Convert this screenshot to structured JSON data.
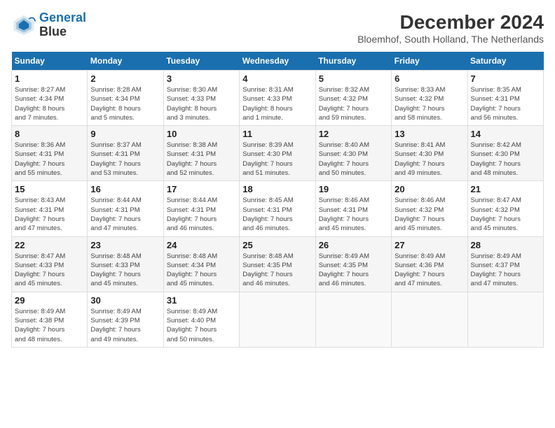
{
  "header": {
    "logo_line1": "General",
    "logo_line2": "Blue",
    "month_title": "December 2024",
    "subtitle": "Bloemhof, South Holland, The Netherlands"
  },
  "columns": [
    "Sunday",
    "Monday",
    "Tuesday",
    "Wednesday",
    "Thursday",
    "Friday",
    "Saturday"
  ],
  "weeks": [
    [
      {
        "day": "1",
        "info": "Sunrise: 8:27 AM\nSunset: 4:34 PM\nDaylight: 8 hours\nand 7 minutes."
      },
      {
        "day": "2",
        "info": "Sunrise: 8:28 AM\nSunset: 4:34 PM\nDaylight: 8 hours\nand 5 minutes."
      },
      {
        "day": "3",
        "info": "Sunrise: 8:30 AM\nSunset: 4:33 PM\nDaylight: 8 hours\nand 3 minutes."
      },
      {
        "day": "4",
        "info": "Sunrise: 8:31 AM\nSunset: 4:33 PM\nDaylight: 8 hours\nand 1 minute."
      },
      {
        "day": "5",
        "info": "Sunrise: 8:32 AM\nSunset: 4:32 PM\nDaylight: 7 hours\nand 59 minutes."
      },
      {
        "day": "6",
        "info": "Sunrise: 8:33 AM\nSunset: 4:32 PM\nDaylight: 7 hours\nand 58 minutes."
      },
      {
        "day": "7",
        "info": "Sunrise: 8:35 AM\nSunset: 4:31 PM\nDaylight: 7 hours\nand 56 minutes."
      }
    ],
    [
      {
        "day": "8",
        "info": "Sunrise: 8:36 AM\nSunset: 4:31 PM\nDaylight: 7 hours\nand 55 minutes."
      },
      {
        "day": "9",
        "info": "Sunrise: 8:37 AM\nSunset: 4:31 PM\nDaylight: 7 hours\nand 53 minutes."
      },
      {
        "day": "10",
        "info": "Sunrise: 8:38 AM\nSunset: 4:31 PM\nDaylight: 7 hours\nand 52 minutes."
      },
      {
        "day": "11",
        "info": "Sunrise: 8:39 AM\nSunset: 4:30 PM\nDaylight: 7 hours\nand 51 minutes."
      },
      {
        "day": "12",
        "info": "Sunrise: 8:40 AM\nSunset: 4:30 PM\nDaylight: 7 hours\nand 50 minutes."
      },
      {
        "day": "13",
        "info": "Sunrise: 8:41 AM\nSunset: 4:30 PM\nDaylight: 7 hours\nand 49 minutes."
      },
      {
        "day": "14",
        "info": "Sunrise: 8:42 AM\nSunset: 4:30 PM\nDaylight: 7 hours\nand 48 minutes."
      }
    ],
    [
      {
        "day": "15",
        "info": "Sunrise: 8:43 AM\nSunset: 4:31 PM\nDaylight: 7 hours\nand 47 minutes."
      },
      {
        "day": "16",
        "info": "Sunrise: 8:44 AM\nSunset: 4:31 PM\nDaylight: 7 hours\nand 47 minutes."
      },
      {
        "day": "17",
        "info": "Sunrise: 8:44 AM\nSunset: 4:31 PM\nDaylight: 7 hours\nand 46 minutes."
      },
      {
        "day": "18",
        "info": "Sunrise: 8:45 AM\nSunset: 4:31 PM\nDaylight: 7 hours\nand 46 minutes."
      },
      {
        "day": "19",
        "info": "Sunrise: 8:46 AM\nSunset: 4:31 PM\nDaylight: 7 hours\nand 45 minutes."
      },
      {
        "day": "20",
        "info": "Sunrise: 8:46 AM\nSunset: 4:32 PM\nDaylight: 7 hours\nand 45 minutes."
      },
      {
        "day": "21",
        "info": "Sunrise: 8:47 AM\nSunset: 4:32 PM\nDaylight: 7 hours\nand 45 minutes."
      }
    ],
    [
      {
        "day": "22",
        "info": "Sunrise: 8:47 AM\nSunset: 4:33 PM\nDaylight: 7 hours\nand 45 minutes."
      },
      {
        "day": "23",
        "info": "Sunrise: 8:48 AM\nSunset: 4:33 PM\nDaylight: 7 hours\nand 45 minutes."
      },
      {
        "day": "24",
        "info": "Sunrise: 8:48 AM\nSunset: 4:34 PM\nDaylight: 7 hours\nand 45 minutes."
      },
      {
        "day": "25",
        "info": "Sunrise: 8:48 AM\nSunset: 4:35 PM\nDaylight: 7 hours\nand 46 minutes."
      },
      {
        "day": "26",
        "info": "Sunrise: 8:49 AM\nSunset: 4:35 PM\nDaylight: 7 hours\nand 46 minutes."
      },
      {
        "day": "27",
        "info": "Sunrise: 8:49 AM\nSunset: 4:36 PM\nDaylight: 7 hours\nand 47 minutes."
      },
      {
        "day": "28",
        "info": "Sunrise: 8:49 AM\nSunset: 4:37 PM\nDaylight: 7 hours\nand 47 minutes."
      }
    ],
    [
      {
        "day": "29",
        "info": "Sunrise: 8:49 AM\nSunset: 4:38 PM\nDaylight: 7 hours\nand 48 minutes."
      },
      {
        "day": "30",
        "info": "Sunrise: 8:49 AM\nSunset: 4:39 PM\nDaylight: 7 hours\nand 49 minutes."
      },
      {
        "day": "31",
        "info": "Sunrise: 8:49 AM\nSunset: 4:40 PM\nDaylight: 7 hours\nand 50 minutes."
      },
      null,
      null,
      null,
      null
    ]
  ]
}
